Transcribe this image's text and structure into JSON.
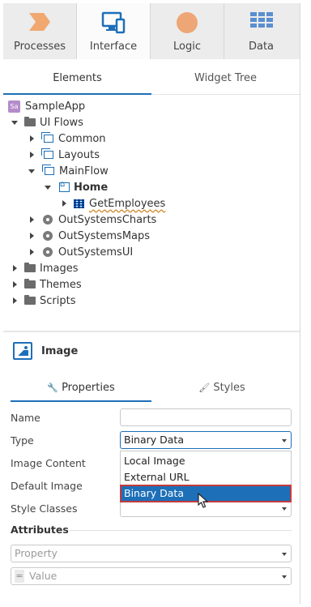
{
  "top_tabs": [
    {
      "label": "Processes",
      "icon": "processes-icon",
      "active": false
    },
    {
      "label": "Interface",
      "icon": "interface-icon",
      "active": true
    },
    {
      "label": "Logic",
      "icon": "logic-icon",
      "active": false
    },
    {
      "label": "Data",
      "icon": "data-icon",
      "active": false
    }
  ],
  "sub_tabs": [
    "Elements",
    "Widget Tree"
  ],
  "tree": {
    "app": "SampleApp",
    "app_badge": "Sa",
    "ui_flows": "UI Flows",
    "common": "Common",
    "layouts": "Layouts",
    "mainflow": "MainFlow",
    "home": "Home",
    "getemployees": "GetEmployees",
    "charts": "OutSystemsCharts",
    "maps": "OutSystemsMaps",
    "ui": "OutSystemsUI",
    "images": "Images",
    "themes": "Themes",
    "scripts": "Scripts"
  },
  "properties": {
    "widget_title": "Image",
    "tab_properties": "Properties",
    "tab_styles": "Styles",
    "labels": {
      "name": "Name",
      "type": "Type",
      "image_content": "Image Content",
      "default_image": "Default Image",
      "style_classes": "Style Classes"
    },
    "name_value": "",
    "type_value": "Binary Data",
    "type_options": [
      "Local Image",
      "External URL",
      "Binary Data"
    ],
    "attributes_title": "Attributes",
    "property_placeholder": "Property",
    "value_prefix": "=",
    "value_placeholder": "Value"
  },
  "colors": {
    "accent": "#1d6fb8",
    "processes_icon": "#f0a870",
    "logic_icon": "#eea676",
    "data_icon": "#5a8fd0",
    "selection_outline": "#c43b3b"
  }
}
